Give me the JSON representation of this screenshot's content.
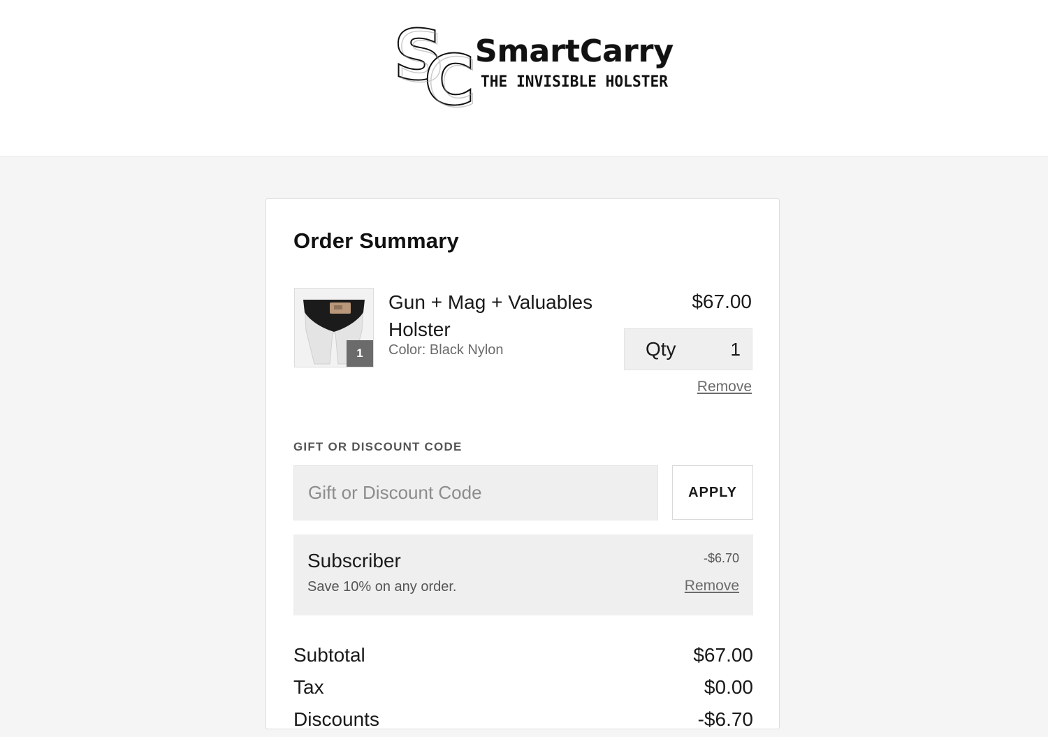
{
  "brand": {
    "logo_mark": "SC",
    "name": "SmartCarry",
    "tagline": "THE INVISIBLE HOLSTER"
  },
  "order_summary": {
    "title": "Order Summary",
    "item": {
      "name": "Gun + Mag + Valuables Holster",
      "variant": "Color: Black Nylon",
      "price": "$67.00",
      "quantity_badge": "1",
      "qty_label": "Qty",
      "qty_value": "1",
      "remove_label": "Remove"
    },
    "discount": {
      "label": "GIFT OR DISCOUNT CODE",
      "placeholder": "Gift or Discount Code",
      "apply_label": "APPLY"
    },
    "applied_promo": {
      "name": "Subscriber",
      "description": "Save 10% on any order.",
      "amount": "-$6.70",
      "remove_label": "Remove"
    },
    "totals": [
      {
        "label": "Subtotal",
        "value": "$67.00"
      },
      {
        "label": "Tax",
        "value": "$0.00"
      },
      {
        "label": "Discounts",
        "value": "-$6.70"
      }
    ]
  },
  "colors": {
    "page_background": "#f5f5f5",
    "card_background": "#ffffff",
    "input_background": "#efefef",
    "muted_text": "#6b6b6b",
    "qty_badge": "#6b6b6b"
  }
}
